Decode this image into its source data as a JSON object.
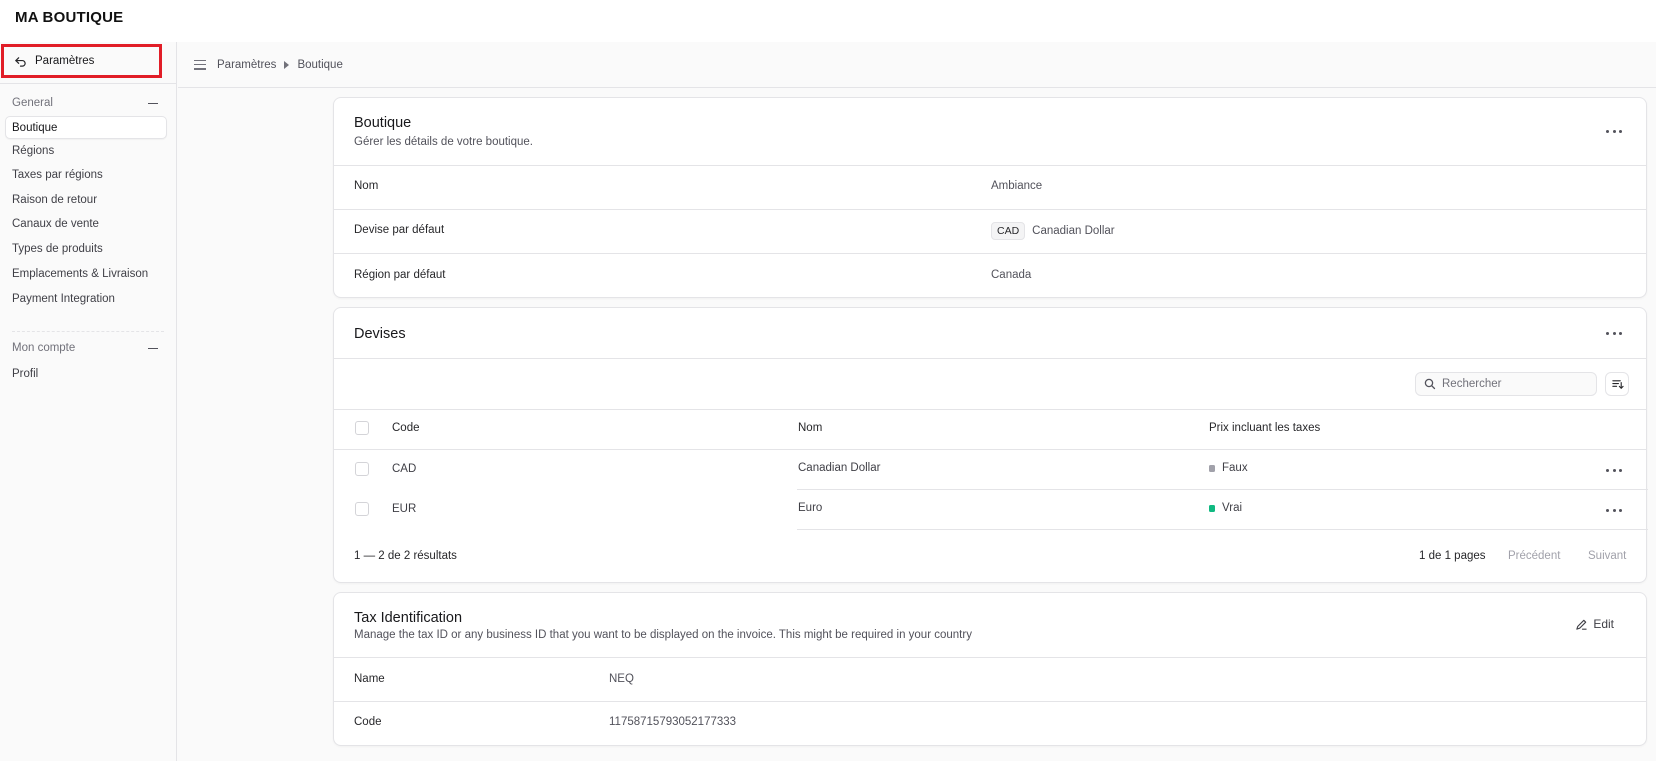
{
  "app": {
    "brand": "MA BOUTIQUE"
  },
  "sidebar": {
    "back_label": "Paramètres",
    "sections": [
      {
        "title": "General",
        "items": [
          "Boutique",
          "Régions",
          "Taxes par régions",
          "Raison de retour",
          "Canaux de vente",
          "Types de produits",
          "Emplacements & Livraison",
          "Payment Integration"
        ]
      },
      {
        "title": "Mon compte",
        "items": [
          "Profil"
        ]
      }
    ],
    "active_item": "Boutique"
  },
  "breadcrumb": [
    "Paramètres",
    "Boutique"
  ],
  "store_card": {
    "title": "Boutique",
    "subtitle": "Gérer les détails de votre boutique.",
    "rows": [
      {
        "label": "Nom",
        "value": "Ambiance"
      },
      {
        "label": "Devise par défaut",
        "badge": "CAD",
        "value": "Canadian Dollar"
      },
      {
        "label": "Région par défaut",
        "value": "Canada"
      }
    ]
  },
  "currencies_card": {
    "title": "Devises",
    "search_placeholder": "Rechercher",
    "columns": [
      "Code",
      "Nom",
      "Prix incluant les taxes"
    ],
    "rows": [
      {
        "code": "CAD",
        "name": "Canadian Dollar",
        "tax_inclusive": "Faux",
        "status_color": "#a1a1aa"
      },
      {
        "code": "EUR",
        "name": "Euro",
        "tax_inclusive": "Vrai",
        "status_color": "#10b981"
      }
    ],
    "pagination": {
      "count": "1 — 2 de 2 résultats",
      "pages": "1 de 1 pages",
      "prev": "Précédent",
      "next": "Suivant"
    }
  },
  "tax_card": {
    "title": "Tax Identification",
    "subtitle": "Manage the tax ID or any business ID that you want to be displayed on the invoice. This might be required in your country",
    "edit_label": "Edit",
    "rows": [
      {
        "label": "Name",
        "value": "NEQ"
      },
      {
        "label": "Code",
        "value": "11758715793052177333"
      }
    ]
  },
  "colors": {
    "highlight": "#e11d27",
    "status_false": "#a1a1aa",
    "status_true": "#10b981"
  }
}
